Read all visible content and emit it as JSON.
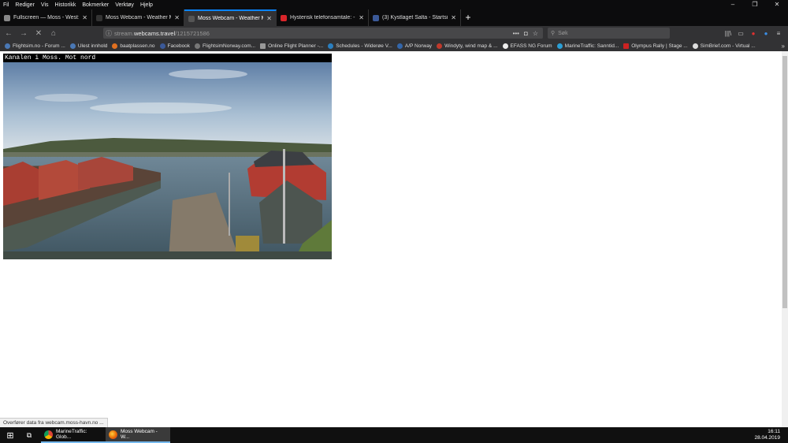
{
  "menu": [
    "Fil",
    "Rediger",
    "Vis",
    "Historikk",
    "Bokmerker",
    "Verktøy",
    "Hjelp"
  ],
  "window_controls": [
    "–",
    "❐",
    "✕"
  ],
  "tabs": [
    {
      "label": "Fullscreen — Moss - West: Boli",
      "color": "#888888",
      "active": false
    },
    {
      "label": "Moss Webcam - Weather Moss",
      "color": "#333333",
      "active": false
    },
    {
      "label": "Moss Webcam - Weather Moss",
      "color": "#555555",
      "active": true
    },
    {
      "label": "Hysterisk telefonsamtale: - Jeg",
      "color": "#d9252a",
      "active": false
    },
    {
      "label": "(3) Kystlaget Salta - Startside",
      "color": "#3b5998",
      "active": false
    }
  ],
  "newtab": "+",
  "nav": {
    "back": "←",
    "forward": "→",
    "stop": "✕",
    "home": "⌂"
  },
  "url": {
    "prefix": "stream.",
    "domain": "webcams.travel",
    "path": "/1215721586"
  },
  "search": {
    "placeholder": "Søk"
  },
  "toolbar_icons": [
    "|||\\",
    "▭",
    "●",
    "●",
    "≡"
  ],
  "bookmarks": [
    {
      "label": "Flightsim.no - Forum ...",
      "color": "#4a78b5"
    },
    {
      "label": "Ulest innhold",
      "color": "#4a78b5"
    },
    {
      "label": "baatplassen.no",
      "color": "#e07020"
    },
    {
      "label": "Facebook",
      "color": "#3b5998"
    },
    {
      "label": "FlightsimNorway.com...",
      "color": "#777777"
    },
    {
      "label": "Online Flight Planner -...",
      "color": "#999999"
    },
    {
      "label": "Schedules - Widerøe V...",
      "color": "#2a7fc0"
    },
    {
      "label": "A/P Norway",
      "color": "#3366aa"
    },
    {
      "label": "Windyty, wind map & ...",
      "color": "#c0392b"
    },
    {
      "label": "EFASS NG Forum",
      "color": "#eeeeee"
    },
    {
      "label": "MarineTraffic: Sanntid...",
      "color": "#2a9fd6"
    },
    {
      "label": "Olympus Rally | Stage ...",
      "color": "#cc2222"
    },
    {
      "label": "SimBrief.com - Virtual ...",
      "color": "#dddddd"
    }
  ],
  "bookmarks_more": "»",
  "webcam": {
    "title": "Kanalen i Moss. Mot nord"
  },
  "status_text": "Overfører data fra webcam.moss-havn.no ...",
  "taskbar": {
    "start": "⊞",
    "taskview": "⧉",
    "apps": [
      {
        "label": "MarineTraffic: Glob...",
        "color": "#e8b400",
        "active": false
      },
      {
        "label": "Moss Webcam - W...",
        "color": "#e66000",
        "active": true
      }
    ]
  },
  "clock": {
    "time": "16:11",
    "date": "28.04.2019"
  }
}
